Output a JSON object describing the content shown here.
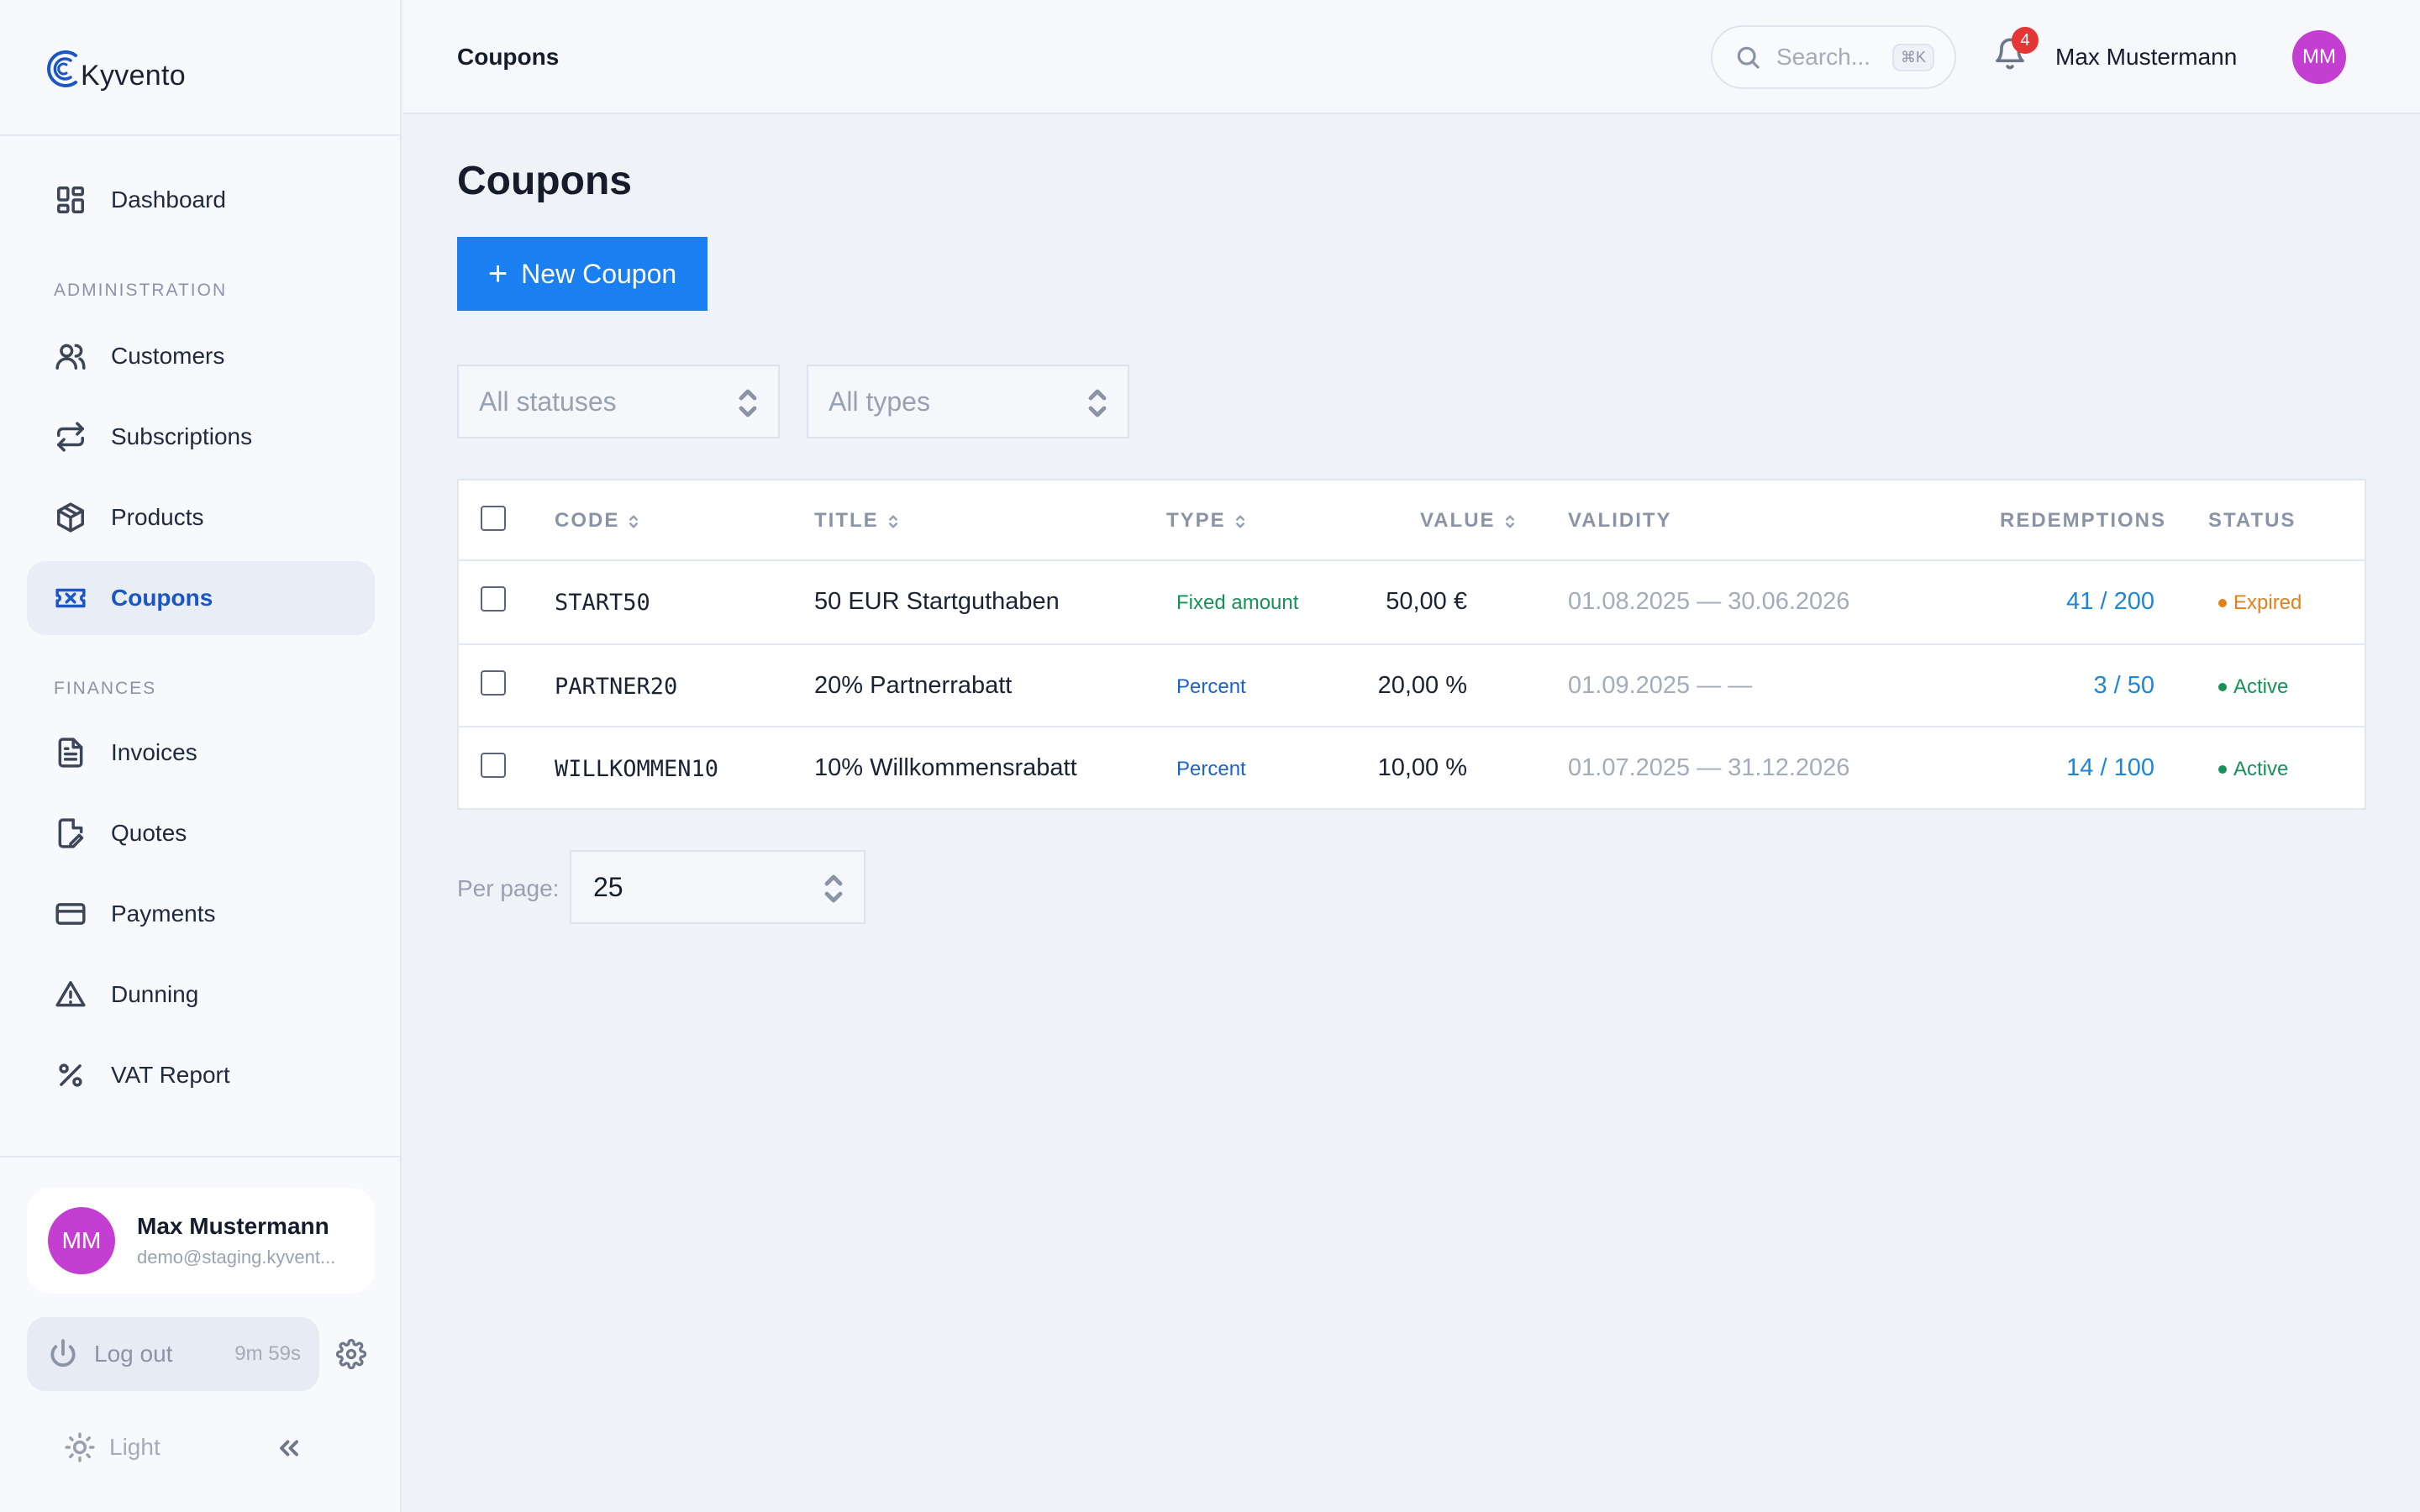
{
  "app": {
    "logo_text": "Kyvento"
  },
  "sidebar": {
    "dashboard": "Dashboard",
    "section_admin": "ADMINISTRATION",
    "section_finances": "FINANCES",
    "items": [
      {
        "label": "Customers",
        "icon": "users-icon"
      },
      {
        "label": "Subscriptions",
        "icon": "repeat-icon"
      },
      {
        "label": "Products",
        "icon": "box-icon"
      },
      {
        "label": "Coupons",
        "icon": "ticket-icon",
        "active": true
      },
      {
        "label": "Invoices",
        "icon": "document-icon"
      },
      {
        "label": "Quotes",
        "icon": "document-edit-icon"
      },
      {
        "label": "Payments",
        "icon": "credit-card-icon"
      },
      {
        "label": "Dunning",
        "icon": "warning-icon"
      },
      {
        "label": "VAT Report",
        "icon": "percent-icon"
      }
    ],
    "user": {
      "initials": "MM",
      "name": "Max Mustermann",
      "email": "demo@staging.kyvent..."
    },
    "logout_label": "Log out",
    "session_timer": "9m 59s",
    "theme_label": "Light"
  },
  "header": {
    "breadcrumb": "Coupons",
    "search_placeholder": "Search...",
    "search_shortcut": "⌘K",
    "notification_count": "4",
    "user_name": "Max Mustermann",
    "user_initials": "MM"
  },
  "main": {
    "title": "Coupons",
    "new_button": "New Coupon",
    "filter_status": "All statuses",
    "filter_type": "All types",
    "columns": {
      "code": "CODE",
      "title": "TITLE",
      "type": "TYPE",
      "value": "VALUE",
      "validity": "VALIDITY",
      "redemptions": "REDEMPTIONS",
      "status": "STATUS"
    },
    "rows": [
      {
        "code": "START50",
        "title": "50 EUR Startguthaben",
        "type": "Fixed amount",
        "value": "50,00 €",
        "validity": "01.08.2025 — 30.06.2026",
        "redemptions": "41 / 200",
        "status": "Expired"
      },
      {
        "code": "PARTNER20",
        "title": "20% Partnerrabatt",
        "type": "Percent",
        "value": "20,00 %",
        "validity": "01.09.2025 — —",
        "redemptions": "3 / 50",
        "status": "Active"
      },
      {
        "code": "WILLKOMMEN10",
        "title": "10% Willkommensrabatt",
        "type": "Percent",
        "value": "10,00 %",
        "validity": "01.07.2025 — 31.12.2026",
        "redemptions": "14 / 100",
        "status": "Active"
      }
    ],
    "per_page_label": "Per page:",
    "per_page_value": "25"
  },
  "colors": {
    "accent": "#1a7ff0",
    "active_nav": "#1b56c4",
    "avatar": "#c43fd1",
    "status_expired": "#e2801c",
    "status_active": "#17915a"
  }
}
